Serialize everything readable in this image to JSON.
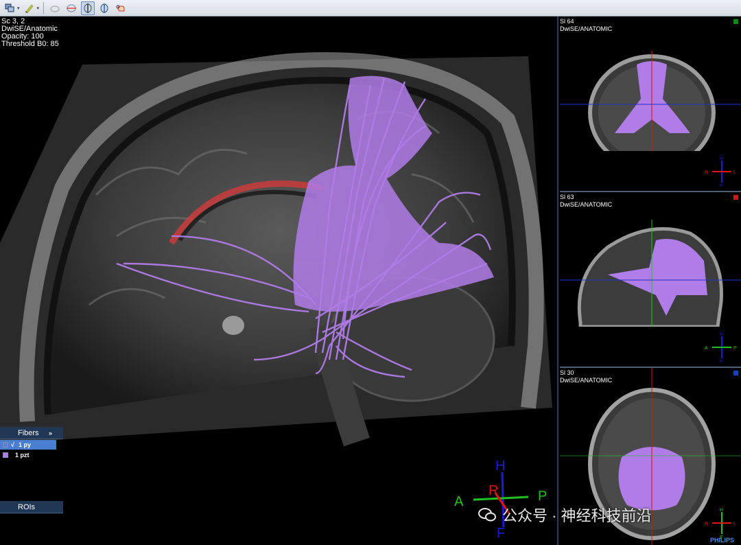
{
  "toolbar": {
    "buttons": [
      {
        "name": "layout-view-icon"
      },
      {
        "name": "brush-edit-icon"
      },
      {
        "name": "sphere-roi-icon"
      },
      {
        "name": "plane-cut-icon"
      },
      {
        "name": "sagittal-view-icon"
      },
      {
        "name": "split-view-icon"
      },
      {
        "name": "hand-pointer-icon"
      }
    ]
  },
  "main": {
    "overlay_lines": [
      "Sc 3, 2",
      "DwiSE/Anatomic",
      "Opacity: 100",
      "Threshold B0: 85"
    ],
    "fibers_panel": {
      "title": "Fibers",
      "expand": "»",
      "items": [
        {
          "check": "√",
          "label": "1 py",
          "color": "#5b7fd6"
        },
        {
          "check": "",
          "label": "1 pzt",
          "color": "#b07ce8"
        }
      ]
    },
    "rois_panel": {
      "title": "ROIs"
    },
    "orientation": {
      "H": "H",
      "F": "F",
      "A": "A",
      "P": "P",
      "R": "R"
    }
  },
  "side_views": [
    {
      "slice": "Sl 64",
      "series": "DwiSE/ANATOMIC",
      "marker_color": "#0a8f0a",
      "orient": {
        "R": "R",
        "L": "L",
        "H": "H",
        "F": "F"
      }
    },
    {
      "slice": "Sl 63",
      "series": "DwiSE/ANATOMIC",
      "marker_color": "#e01010",
      "orient": {
        "A": "A",
        "P": "P",
        "H": "H",
        "F": "F"
      }
    },
    {
      "slice": "Sl 30",
      "series": "DwiSE/ANATOMIC",
      "marker_color": "#1040e0",
      "orient": {
        "R": "R",
        "L": "L",
        "H": "H",
        "F": "F"
      }
    }
  ],
  "watermark": "公众号 · 神经科技前沿",
  "brand": "PHILIPS",
  "colors": {
    "fiber": "#b07ce8",
    "panel": "#203856",
    "axis_h": "#1b1bd8",
    "axis_ap": "#1fc21f",
    "axis_r": "#e01414"
  }
}
